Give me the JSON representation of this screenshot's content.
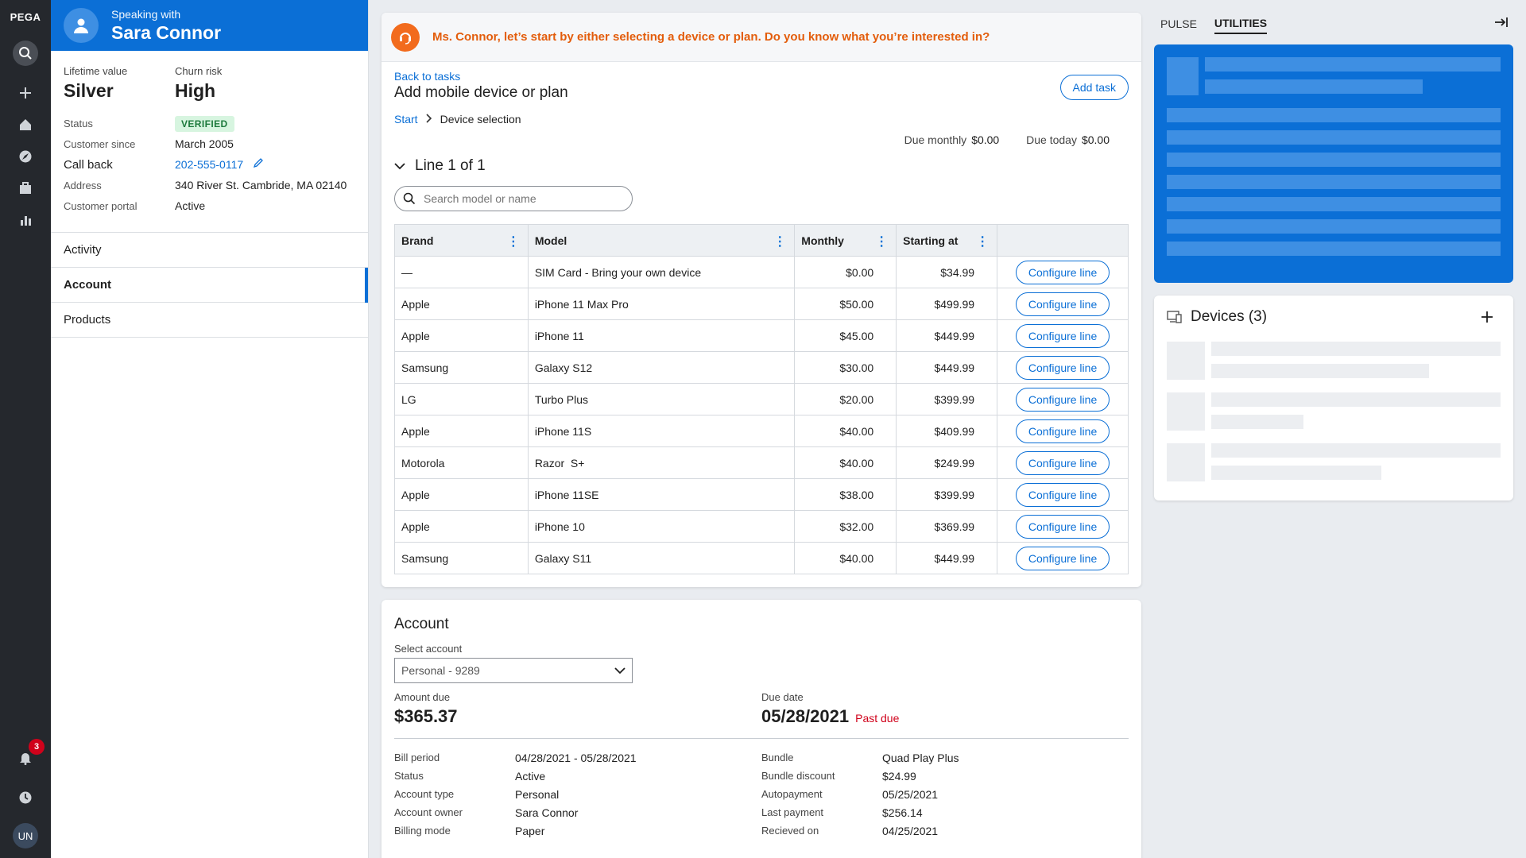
{
  "rail": {
    "logo": "PEGA",
    "notification_count": "3",
    "user_initials": "UN"
  },
  "customer": {
    "speaking_with": "Speaking with",
    "name": "Sara Connor",
    "lifetime_value_label": "Lifetime value",
    "lifetime_value": "Silver",
    "churn_risk_label": "Churn risk",
    "churn_risk": "High",
    "status_label": "Status",
    "status": "VERIFIED",
    "since_label": "Customer since",
    "since": "March 2005",
    "callback_label": "Call back",
    "callback": "202-555-0117",
    "address_label": "Address",
    "address": "340 River St. Cambride, MA 02140",
    "portal_label": "Customer portal",
    "portal": "Active"
  },
  "nav": {
    "items": [
      {
        "label": "Activity",
        "active": false
      },
      {
        "label": "Account",
        "active": true
      },
      {
        "label": "Products",
        "active": false
      }
    ]
  },
  "task": {
    "script": "Ms. Connor, let’s start by either selecting a device or plan. Do you know what you’re interested in?",
    "back_label": "Back to tasks",
    "title": "Add mobile device or plan",
    "add_task_label": "Add task",
    "crumb_start": "Start",
    "crumb_current": "Device selection",
    "due_monthly_label": "Due monthly",
    "due_monthly": "$0.00",
    "due_today_label": "Due today",
    "due_today": "$0.00",
    "line_label": "Line 1 of 1",
    "search_placeholder": "Search model or name",
    "columns": {
      "brand": "Brand",
      "model": "Model",
      "monthly": "Monthly",
      "starting": "Starting at"
    },
    "configure_label": "Configure line",
    "rows": [
      {
        "brand": "—",
        "model": "SIM Card - Bring your own device",
        "monthly": "$0.00",
        "starting": "$34.99"
      },
      {
        "brand": "Apple",
        "model": "iPhone 11 Max Pro",
        "monthly": "$50.00",
        "starting": "$499.99"
      },
      {
        "brand": "Apple",
        "model": "iPhone 11",
        "monthly": "$45.00",
        "starting": "$449.99"
      },
      {
        "brand": "Samsung",
        "model": "Galaxy S12",
        "monthly": "$30.00",
        "starting": "$449.99"
      },
      {
        "brand": "LG",
        "model": "Turbo Plus",
        "monthly": "$20.00",
        "starting": "$399.99"
      },
      {
        "brand": "Apple",
        "model": "iPhone 11S",
        "monthly": "$40.00",
        "starting": "$409.99"
      },
      {
        "brand": "Motorola",
        "model": "Razor  S+",
        "monthly": "$40.00",
        "starting": "$249.99"
      },
      {
        "brand": "Apple",
        "model": "iPhone 11SE",
        "monthly": "$38.00",
        "starting": "$399.99"
      },
      {
        "brand": "Apple",
        "model": "iPhone 10",
        "monthly": "$32.00",
        "starting": "$369.99"
      },
      {
        "brand": "Samsung",
        "model": "Galaxy S11",
        "monthly": "$40.00",
        "starting": "$449.99"
      }
    ]
  },
  "account": {
    "title": "Account",
    "select_label": "Select account",
    "selected": "Personal - 9289",
    "amount_due_label": "Amount due",
    "amount_due": "$365.37",
    "due_date_label": "Due date",
    "due_date": "05/28/2021",
    "past_due": "Past due",
    "left": [
      {
        "k": "Bill period",
        "v": "04/28/2021 - 05/28/2021"
      },
      {
        "k": "Status",
        "v": "Active"
      },
      {
        "k": "Account type",
        "v": "Personal"
      },
      {
        "k": "Account owner",
        "v": "Sara Connor"
      },
      {
        "k": "Billing mode",
        "v": "Paper"
      }
    ],
    "right": [
      {
        "k": "Bundle",
        "v": "Quad Play Plus"
      },
      {
        "k": "Bundle discount",
        "v": "$24.99"
      },
      {
        "k": "Autopayment",
        "v": "05/25/2021"
      },
      {
        "k": "Last payment",
        "v": "$256.14"
      },
      {
        "k": "Recieved on",
        "v": "04/25/2021"
      }
    ]
  },
  "utilities": {
    "tab_pulse": "PULSE",
    "tab_utilities": "UTILITIES",
    "devices_title": "Devices (3)"
  },
  "colors": {
    "brand_blue": "#0b6fd6",
    "script_orange": "#e35d0c",
    "past_due_red": "#d0021b",
    "rail_dark": "#25282d"
  }
}
